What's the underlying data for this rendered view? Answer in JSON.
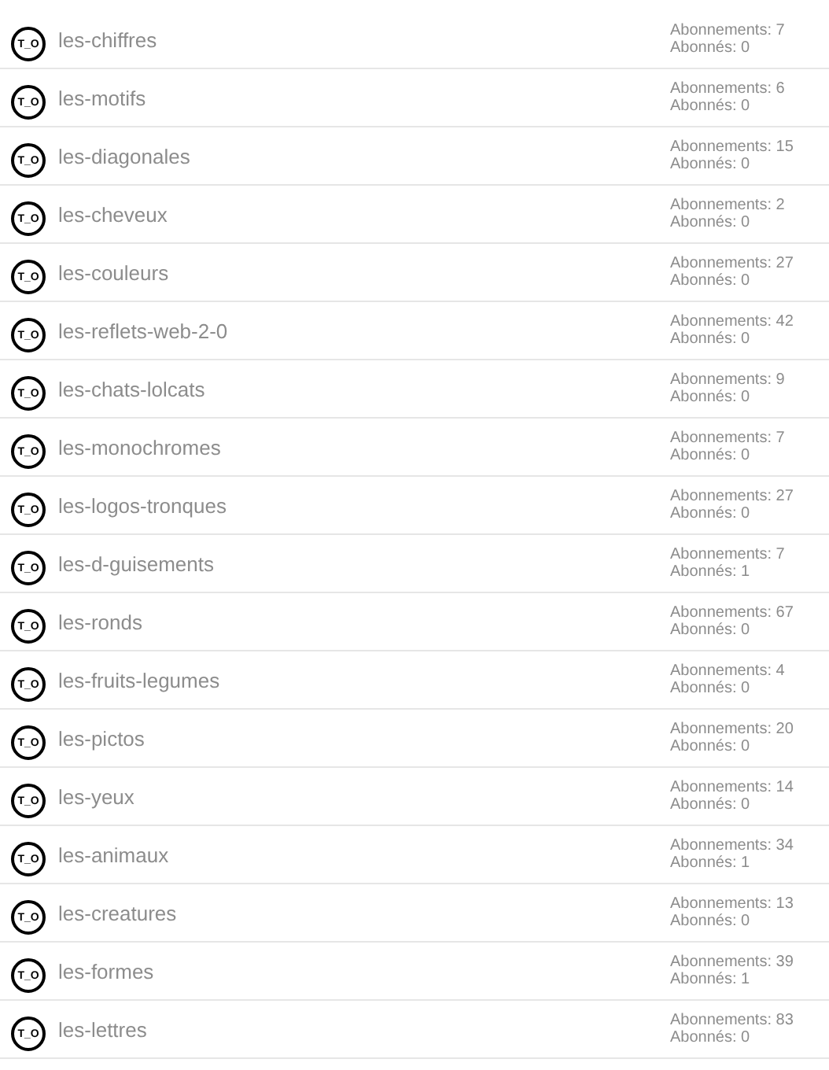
{
  "lists": [
    {
      "avatar": "T_O",
      "name": "les-chiffres",
      "subscriptions": "Abonnements: 7",
      "subscribers": "Abonnés: 0"
    },
    {
      "avatar": "T_O",
      "name": "les-motifs",
      "subscriptions": "Abonnements: 6",
      "subscribers": "Abonnés: 0"
    },
    {
      "avatar": "T_O",
      "name": "les-diagonales",
      "subscriptions": "Abonnements: 15",
      "subscribers": "Abonnés: 0"
    },
    {
      "avatar": "T_O",
      "name": "les-cheveux",
      "subscriptions": "Abonnements: 2",
      "subscribers": "Abonnés: 0"
    },
    {
      "avatar": "T_O",
      "name": "les-couleurs",
      "subscriptions": "Abonnements: 27",
      "subscribers": "Abonnés: 0"
    },
    {
      "avatar": "T_O",
      "name": "les-reflets-web-2-0",
      "subscriptions": "Abonnements: 42",
      "subscribers": "Abonnés: 0"
    },
    {
      "avatar": "T_O",
      "name": "les-chats-lolcats",
      "subscriptions": "Abonnements: 9",
      "subscribers": "Abonnés: 0"
    },
    {
      "avatar": "T_O",
      "name": "les-monochromes",
      "subscriptions": "Abonnements: 7",
      "subscribers": "Abonnés: 0"
    },
    {
      "avatar": "T_O",
      "name": "les-logos-tronques",
      "subscriptions": "Abonnements: 27",
      "subscribers": "Abonnés: 0"
    },
    {
      "avatar": "T_O",
      "name": "les-d-guisements",
      "subscriptions": "Abonnements: 7",
      "subscribers": "Abonnés: 1"
    },
    {
      "avatar": "T_O",
      "name": "les-ronds",
      "subscriptions": "Abonnements: 67",
      "subscribers": "Abonnés: 0"
    },
    {
      "avatar": "T_O",
      "name": "les-fruits-legumes",
      "subscriptions": "Abonnements: 4",
      "subscribers": "Abonnés: 0"
    },
    {
      "avatar": "T_O",
      "name": "les-pictos",
      "subscriptions": "Abonnements: 20",
      "subscribers": "Abonnés: 0"
    },
    {
      "avatar": "T_O",
      "name": "les-yeux",
      "subscriptions": "Abonnements: 14",
      "subscribers": "Abonnés: 0"
    },
    {
      "avatar": "T_O",
      "name": "les-animaux",
      "subscriptions": "Abonnements: 34",
      "subscribers": "Abonnés: 1"
    },
    {
      "avatar": "T_O",
      "name": "les-creatures",
      "subscriptions": "Abonnements: 13",
      "subscribers": "Abonnés: 0"
    },
    {
      "avatar": "T_O",
      "name": "les-formes",
      "subscriptions": "Abonnements: 39",
      "subscribers": "Abonnés: 1"
    },
    {
      "avatar": "T_O",
      "name": "les-lettres",
      "subscriptions": "Abonnements: 83",
      "subscribers": "Abonnés: 0"
    }
  ]
}
